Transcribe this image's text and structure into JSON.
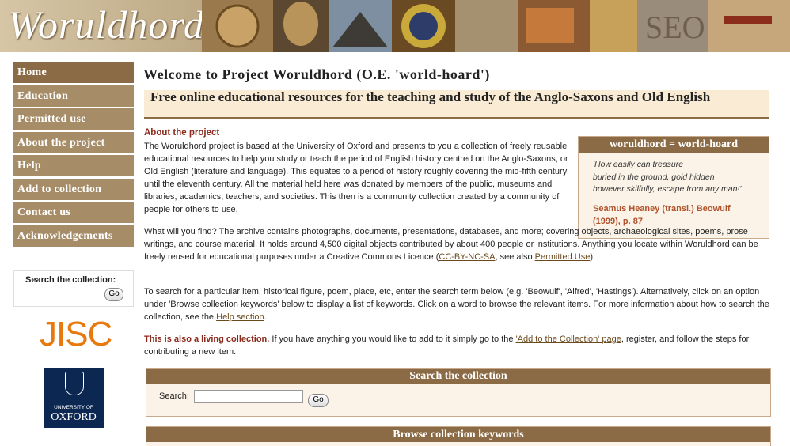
{
  "banner": {
    "logo_text": "Woruldhord"
  },
  "nav": {
    "items": [
      {
        "label": "Home",
        "active": true
      },
      {
        "label": "Education"
      },
      {
        "label": "Permitted use"
      },
      {
        "label": "About the project"
      },
      {
        "label": "Help"
      },
      {
        "label": "Add to collection"
      },
      {
        "label": "Contact us"
      },
      {
        "label": "Acknowledgements"
      }
    ]
  },
  "side_search": {
    "label": "Search the collection:",
    "go_label": "Go"
  },
  "logos": {
    "jisc": "JISC",
    "oxford_line1": "UNIVERSITY OF",
    "oxford_line2": "OXFORD"
  },
  "main": {
    "title": "Welcome to Project Woruldhord (O.E. 'world-hoard')",
    "tagline": "Free online educational resources for the teaching and study of the Anglo-Saxons and Old English",
    "about_heading": "About the project",
    "about_text": "The Woruldhord project is based at the University of Oxford and presents to you a collection of freely reusable educational resources to help you study or teach the period of English history centred on the Anglo-Saxons, or Old English (literature and language). This equates to a period of history roughly covering the mid-fifth century until the eleventh century. All the material held here was donated by members of the public, museums and libraries, academics, teachers, and societies. This then is a community collection created by a community of people for others to use.",
    "find_text": "What will you find? The archive contains photographs, documents, presentations, databases, and more; covering objects, archaeological sites, poems, prose writings, and course material. It holds around 4,500 digital objects contributed by about 400 people or institutions. Anything you locate within Woruldhord can be freely reused for educational purposes under a Creative Commons Licence (",
    "find_link1": "CC-BY-NC-SA",
    "find_mid": ", see also ",
    "find_link2": "Permitted Use",
    "find_end": ").",
    "search_text": "To search for a particular item, historical figure, poem, place, etc, enter the search term below (e.g. 'Beowulf', 'Alfred', 'Hastings'). Alternatively, click on an option under 'Browse collection keywords' below to display a list of keywords. Click on a word to browse the relevant items. For more information about how to search the collection, see the ",
    "search_link": "Help section",
    "search_end": ".",
    "living_bold": "This is also a living collection.",
    "living_text": " If you have anything you would like to add to it simply go to the ",
    "living_link": "'Add to the Collection' page",
    "living_end": ", register, and follow the steps for contributing a new item."
  },
  "quote": {
    "heading": "woruldhord = world-hoard",
    "lines": [
      "'How easily can treasure",
      "buried in the ground, gold hidden",
      "however skilfully, escape from any man!'"
    ],
    "cite_line1": "Seamus Heaney (transl.) Beowulf",
    "cite_line2": "(1999), p. 87"
  },
  "search_panel": {
    "heading": "Search the collection",
    "label": "Search:",
    "go_label": "Go"
  },
  "browse_panel": {
    "heading": "Browse collection keywords"
  },
  "colors": {
    "accent": "#8b6b45",
    "nav": "#a68c67",
    "heading_red": "#8b2a1b",
    "tagline_bg": "#f9ebd4"
  }
}
